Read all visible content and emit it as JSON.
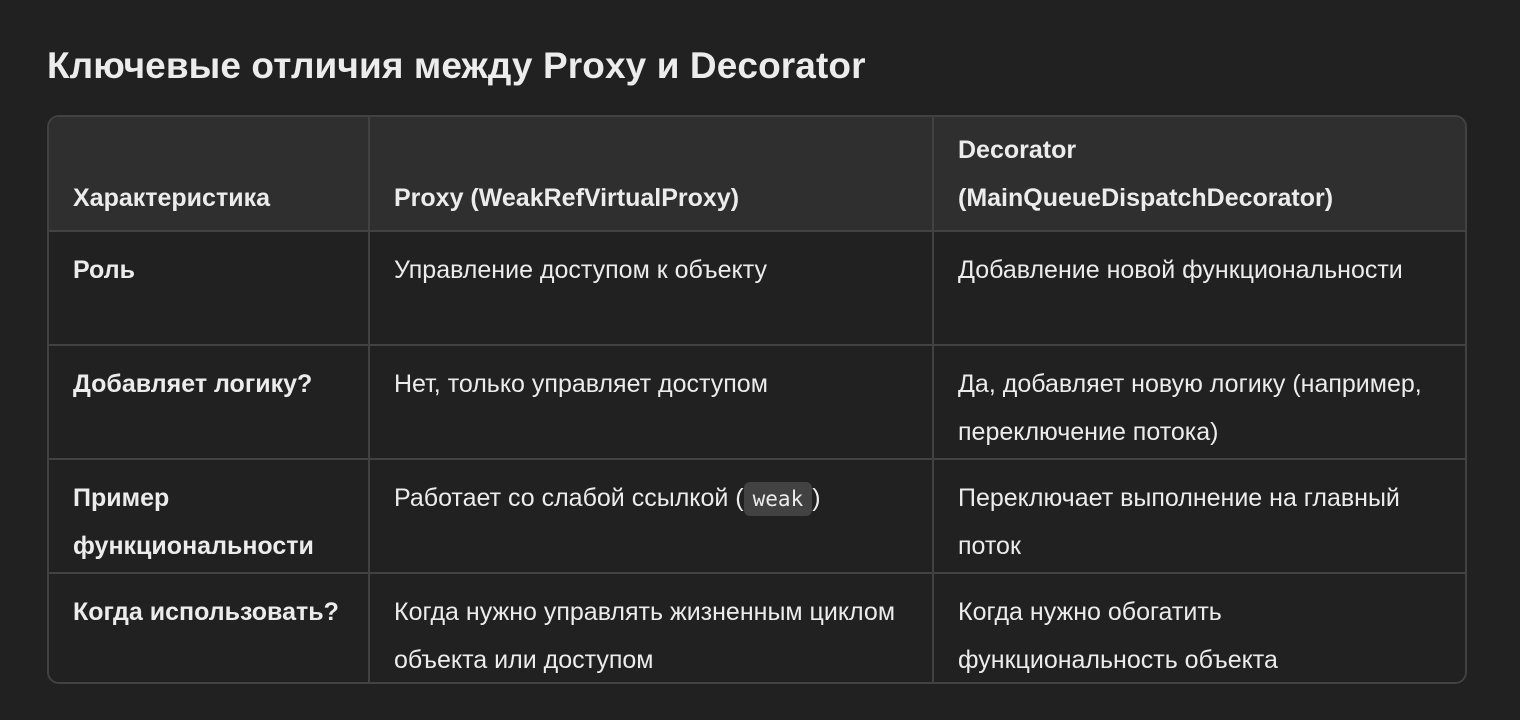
{
  "title": "Ключевые отличия между Proxy и Decorator",
  "table": {
    "headers": [
      "Характеристика",
      "Proxy (WeakRefVirtualProxy)",
      "Decorator (MainQueueDispatchDecorator)"
    ],
    "rows": [
      {
        "feature": "Роль",
        "proxy": "Управление доступом к объекту",
        "decorator": "Добавление новой функциональности"
      },
      {
        "feature": "Добавляет логику?",
        "proxy": "Нет, только управляет доступом",
        "decorator": "Да, добавляет новую логику (например, переключение потока)"
      },
      {
        "feature": "Пример функциональности",
        "proxy_before": "Работает со слабой ссылкой (",
        "proxy_code": "weak",
        "proxy_after": ")",
        "decorator": "Переключает выполнение на главный поток"
      },
      {
        "feature": "Когда использовать?",
        "proxy": "Когда нужно управлять жизненным циклом объекта или доступом",
        "decorator": "Когда нужно обогатить функциональность объекта"
      }
    ]
  }
}
